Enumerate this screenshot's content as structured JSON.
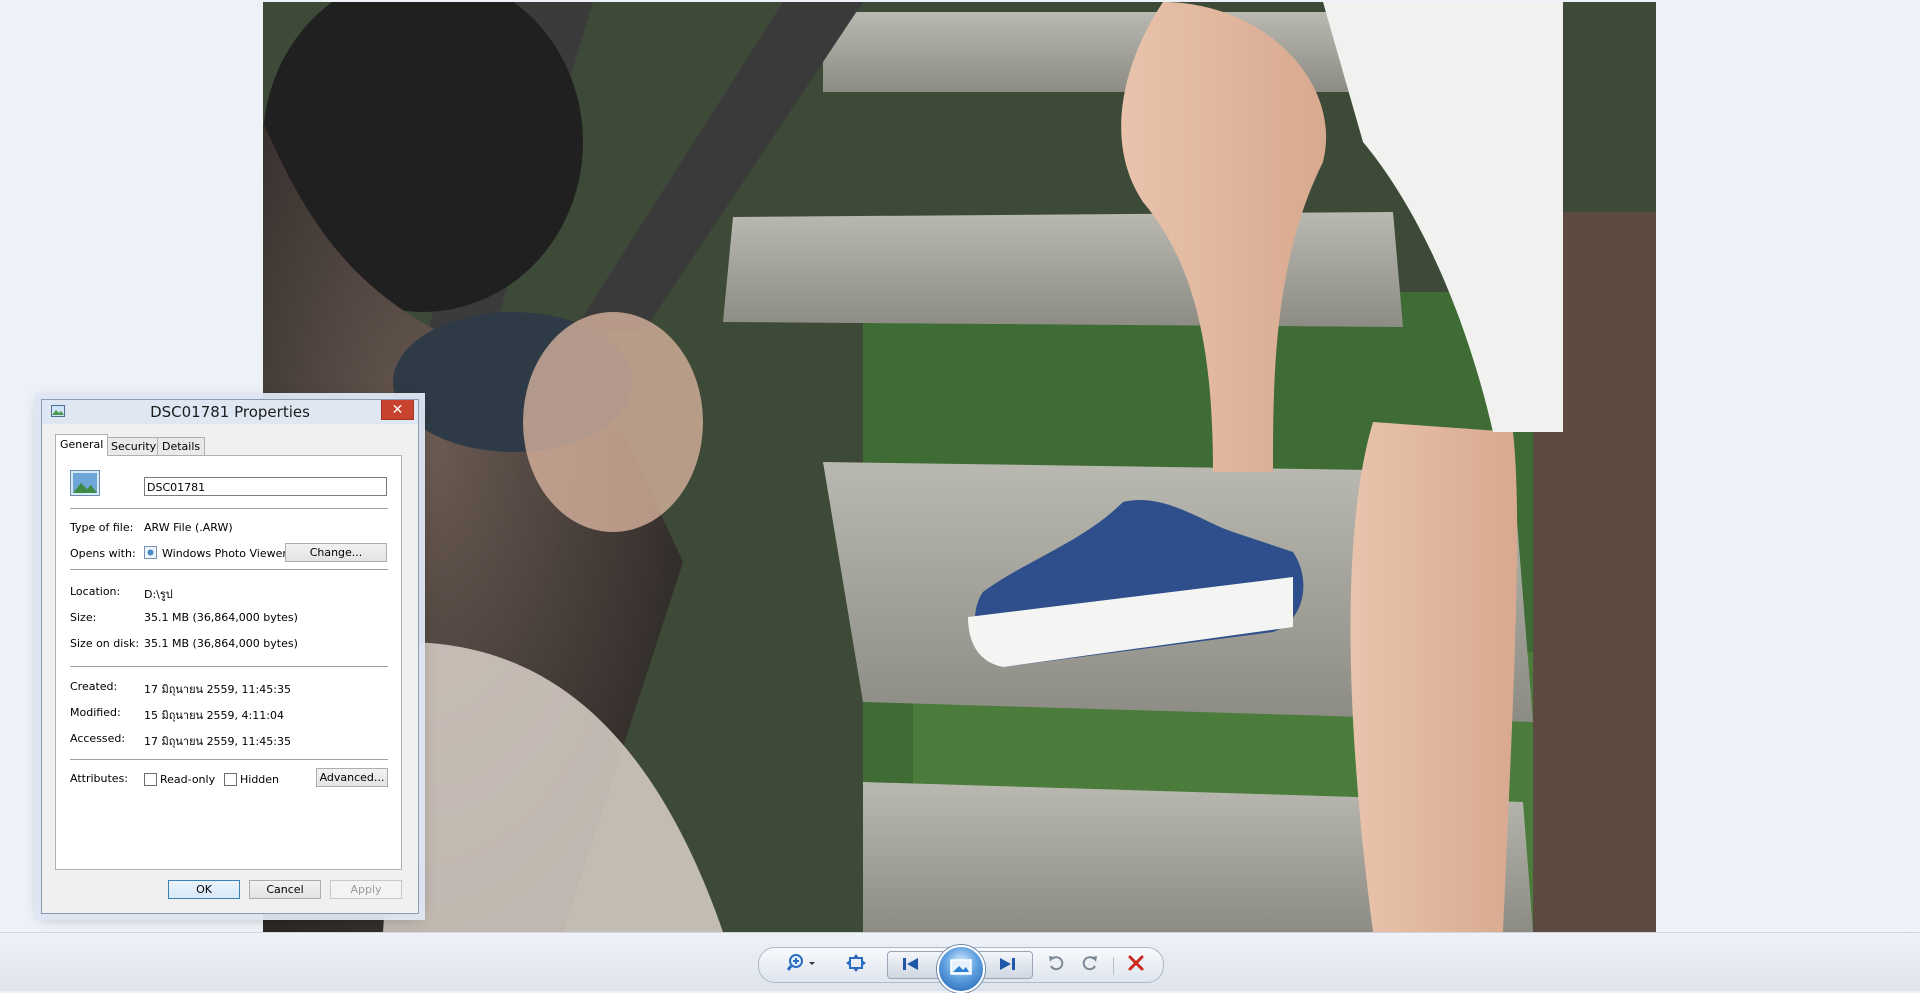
{
  "viewer": {
    "photo_description_icon": "photo"
  },
  "dialog": {
    "title": "DSC01781 Properties",
    "tabs": [
      {
        "label": "General",
        "active": true
      },
      {
        "label": "Security",
        "active": false
      },
      {
        "label": "Details",
        "active": false
      }
    ],
    "file_name": "DSC01781",
    "type_label": "Type of file:",
    "type_value": "ARW File (.ARW)",
    "opens_label": "Opens with:",
    "opens_value": "Windows Photo Viewer",
    "change_button": "Change...",
    "location_label": "Location:",
    "location_value": "D:\\รูป",
    "size_label": "Size:",
    "size_value": "35.1 MB (36,864,000 bytes)",
    "size_disk_label": "Size on disk:",
    "size_disk_value": "35.1 MB (36,864,000 bytes)",
    "created_label": "Created:",
    "created_value": "17 มิถุนายน 2559, 11:45:35",
    "modified_label": "Modified:",
    "modified_value": "15 มิถุนายน 2559, 4:11:04",
    "accessed_label": "Accessed:",
    "accessed_value": "17 มิถุนายน 2559, 11:45:35",
    "attributes_label": "Attributes:",
    "readonly_label": "Read-only",
    "readonly_checked": false,
    "hidden_label": "Hidden",
    "hidden_checked": false,
    "advanced_button": "Advanced...",
    "ok_button": "OK",
    "cancel_button": "Cancel",
    "apply_button": "Apply",
    "close_glyph": "✕"
  },
  "toolbar": {
    "icons": [
      "zoom-icon",
      "actual-size-icon",
      "previous-icon",
      "slideshow-icon",
      "next-icon",
      "rotate-left-icon",
      "rotate-right-icon",
      "delete-icon"
    ]
  },
  "colors": {
    "delete_red": "#c8281e",
    "accent_blue": "#2a6cc0",
    "close_red": "#c7432f"
  }
}
